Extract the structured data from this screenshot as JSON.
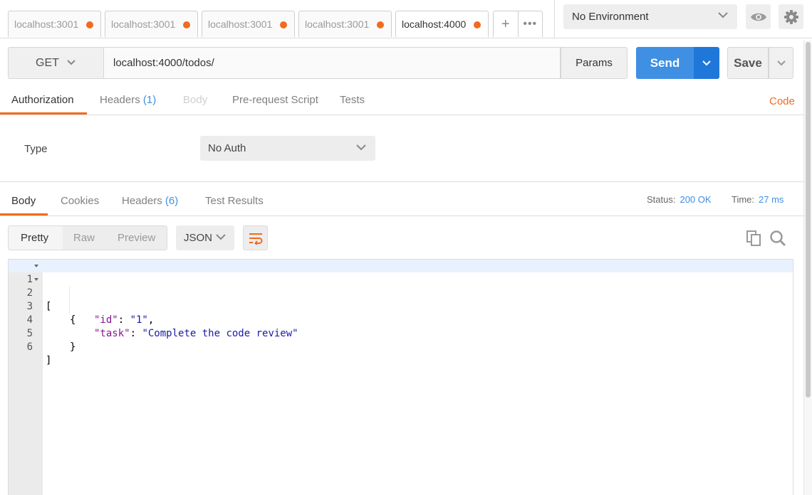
{
  "tabs": [
    {
      "label": "localhost:3001",
      "active": false
    },
    {
      "label": "localhost:3001",
      "active": false
    },
    {
      "label": "localhost:3001",
      "active": false
    },
    {
      "label": "localhost:3001",
      "active": false
    },
    {
      "label": "localhost:4000",
      "active": true
    }
  ],
  "tab_tools": {
    "new_tab": "+",
    "more": "•••"
  },
  "environment": {
    "selected": "No Environment"
  },
  "request": {
    "method": "GET",
    "url": "localhost:4000/todos/",
    "params_label": "Params",
    "send_label": "Send",
    "save_label": "Save"
  },
  "request_tabs": {
    "authorization": "Authorization",
    "headers": "Headers",
    "headers_count": "(1)",
    "body": "Body",
    "prerequest": "Pre-request Script",
    "tests": "Tests",
    "code_link": "Code"
  },
  "auth": {
    "type_label": "Type",
    "type_value": "No Auth"
  },
  "response_tabs": {
    "body": "Body",
    "cookies": "Cookies",
    "headers": "Headers",
    "headers_count": "(6)",
    "test_results": "Test Results"
  },
  "response_meta": {
    "status_label": "Status:",
    "status_value": "200 OK",
    "time_label": "Time:",
    "time_value": "27 ms"
  },
  "view_modes": {
    "pretty": "Pretty",
    "raw": "Raw",
    "preview": "Preview",
    "selected": "Pretty"
  },
  "language": {
    "selected": "JSON"
  },
  "response_body": {
    "line_numbers": [
      "1",
      "2",
      "3",
      "4",
      "5",
      "6"
    ],
    "open_bracket": "[",
    "open_brace": "{",
    "id_key": "\"id\"",
    "id_value": "\"1\"",
    "task_key": "\"task\"",
    "task_value": "\"Complete the code review\"",
    "close_brace": "}",
    "close_bracket": "]"
  },
  "colors": {
    "accent_orange": "#f26b1d",
    "send_blue": "#3f8fe3",
    "link_blue": "#3f8fe3"
  },
  "icons": [
    "chevron-down-icon",
    "eye-icon",
    "gear-icon",
    "wrap-lines-icon",
    "copy-icon",
    "search-icon"
  ]
}
